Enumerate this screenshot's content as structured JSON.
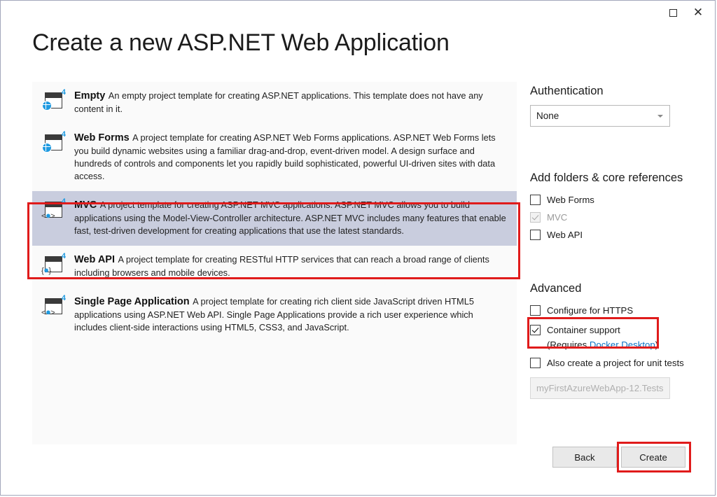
{
  "window": {
    "maximize_icon": "maximize-icon",
    "close_icon": "close-icon"
  },
  "header": {
    "title": "Create a new ASP.NET Web Application"
  },
  "templates": [
    {
      "name": "Empty",
      "description": "An empty project template for creating ASP.NET applications. This template does not have any content in it.",
      "icon": "web-page-globe-icon",
      "badge": "4",
      "selected": false
    },
    {
      "name": "Web Forms",
      "description": "A project template for creating ASP.NET Web Forms applications. ASP.NET Web Forms lets you build dynamic websites using a familiar drag-and-drop, event-driven model. A design surface and hundreds of controls and components let you rapidly build sophisticated, powerful UI-driven sites with data access.",
      "icon": "web-page-globe-icon",
      "badge": "4",
      "selected": false
    },
    {
      "name": "MVC",
      "description": "A project template for creating ASP.NET MVC applications. ASP.NET MVC allows you to build applications using the Model-View-Controller architecture. ASP.NET MVC includes many features that enable fast, test-driven development for creating applications that use the latest standards.",
      "icon": "web-page-code-icon",
      "badge": "4",
      "selected": true
    },
    {
      "name": "Web API",
      "description": "A project template for creating RESTful HTTP services that can reach a broad range of clients including browsers and mobile devices.",
      "icon": "web-page-api-icon",
      "badge": "4",
      "selected": false
    },
    {
      "name": "Single Page Application",
      "description": "A project template for creating rich client side JavaScript driven HTML5 applications using ASP.NET Web API. Single Page Applications provide a rich user experience which includes client-side interactions using HTML5, CSS3, and JavaScript.",
      "icon": "web-page-code-icon",
      "badge": "4",
      "selected": false
    }
  ],
  "authentication": {
    "section_title": "Authentication",
    "selected_value": "None"
  },
  "folders": {
    "section_title": "Add folders & core references",
    "items": [
      {
        "label": "Web Forms",
        "checked": false,
        "disabled": false
      },
      {
        "label": "MVC",
        "checked": true,
        "disabled": true
      },
      {
        "label": "Web API",
        "checked": false,
        "disabled": false
      }
    ]
  },
  "advanced": {
    "section_title": "Advanced",
    "https_label": "Configure for HTTPS",
    "https_checked": false,
    "container_label": "Container support",
    "container_checked": true,
    "container_note_prefix": "(Requires ",
    "container_note_link": "Docker Desktop",
    "container_note_suffix": ")",
    "unit_tests_label": "Also create a project for unit tests",
    "unit_tests_checked": false,
    "test_project_name": "myFirstAzureWebApp-12.Tests"
  },
  "footer": {
    "back_label": "Back",
    "create_label": "Create"
  },
  "annotations": {
    "accent_color": "#e01b1b",
    "selection_color": "#c9cdde",
    "link_color": "#0a72c4"
  }
}
